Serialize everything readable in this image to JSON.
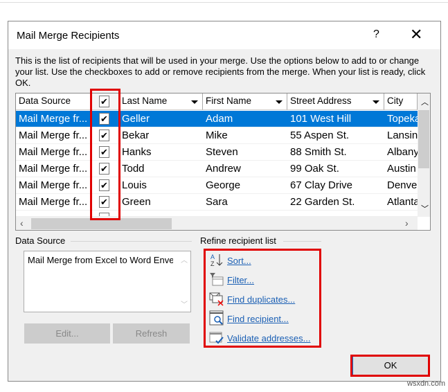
{
  "dialog": {
    "title": "Mail Merge Recipients",
    "help_label": "?",
    "close_label": "✕",
    "description": "This is the list of recipients that will be used in your merge.  Use the options below to add to or change your list.  Use the checkboxes to add or remove recipients from the merge.  When your list is ready, click OK."
  },
  "table": {
    "headers": [
      "Data Source",
      "✔",
      "Last Name",
      "First Name",
      "Street Address",
      "City"
    ],
    "rows": [
      [
        "Mail Merge fr...",
        "✔",
        "Geller",
        "Adam",
        "101 West Hill",
        "Topeka"
      ],
      [
        "Mail Merge fr...",
        "✔",
        "Bekar",
        "Mike",
        "55 Aspen St.",
        "Lansing"
      ],
      [
        "Mail Merge fr...",
        "✔",
        "Hanks",
        "Steven",
        "88 Smith St.",
        "Albany"
      ],
      [
        "Mail Merge fr...",
        "✔",
        "Todd",
        "Andrew",
        "99 Oak St.",
        "Austin"
      ],
      [
        "Mail Merge fr...",
        "✔",
        "Louis",
        "George",
        "67 Clay Drive",
        "Denver"
      ],
      [
        "Mail Merge fr...",
        "✔",
        "Green",
        "Sara",
        "22 Garden St.",
        "Atlanta"
      ]
    ],
    "selected_row": 0
  },
  "data_source": {
    "label": "Data Source",
    "items": [
      "Mail Merge from Excel to Word Enve"
    ],
    "edit_label": "Edit...",
    "refresh_label": "Refresh"
  },
  "refine": {
    "label": "Refine recipient list",
    "links": [
      "Sort...",
      "Filter...",
      "Find duplicates...",
      "Find recipient...",
      "Validate addresses..."
    ]
  },
  "ok_label": "OK",
  "watermark": "wsxdn.com",
  "colors": {
    "selection": "#0078d7",
    "highlight": "#e00000",
    "link": "#1a5fb4"
  }
}
